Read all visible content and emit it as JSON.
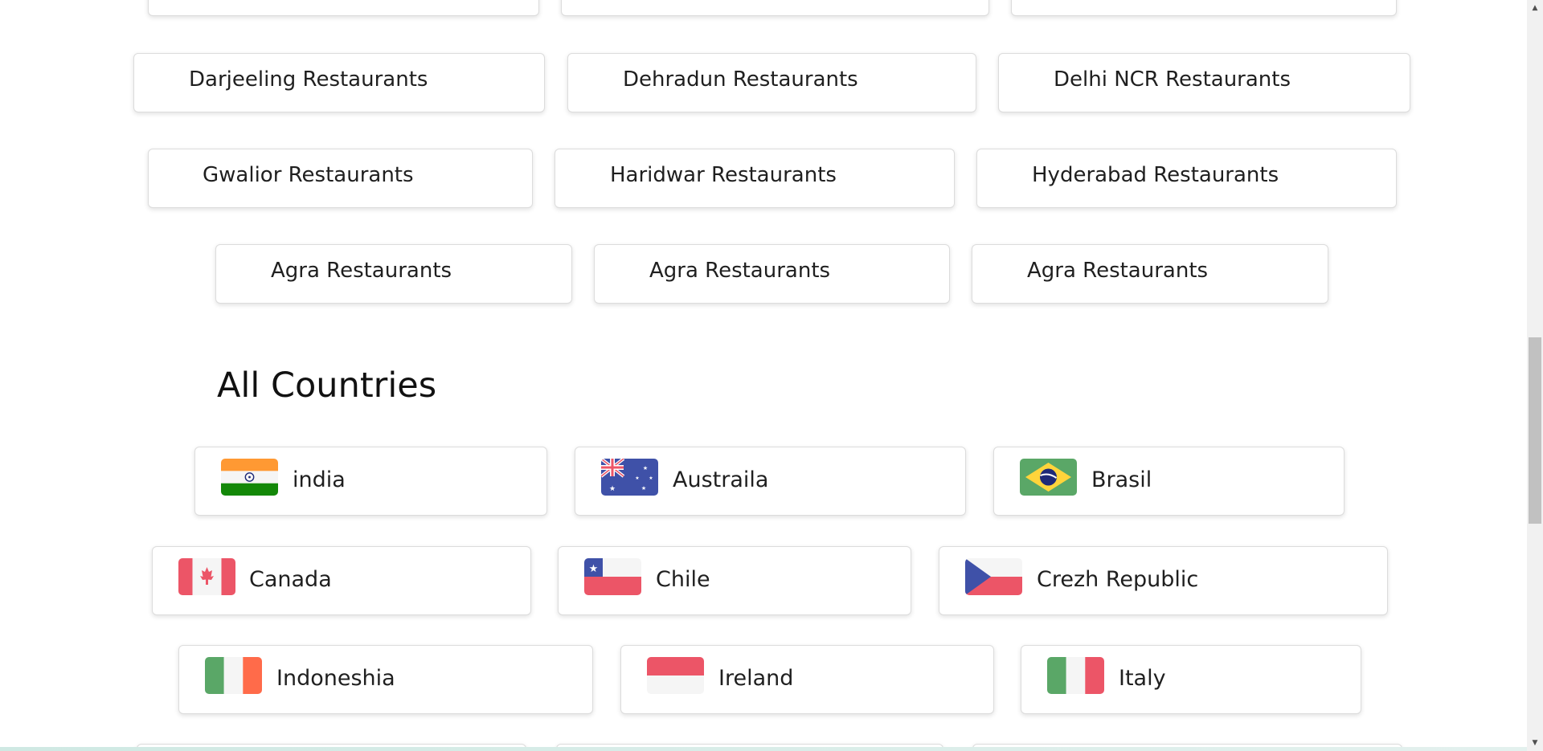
{
  "restaurants": {
    "row2": [
      "Darjeeling Restaurants",
      "Dehradun Restaurants",
      "Delhi NCR Restaurants"
    ],
    "row3": [
      "Gwalior Restaurants",
      "Haridwar Restaurants",
      "Hyderabad Restaurants"
    ],
    "row4": [
      "Agra Restaurants",
      "Agra Restaurants",
      "Agra Restaurants"
    ]
  },
  "countries_section": {
    "title": "All Countries",
    "items": [
      {
        "name": "india",
        "flag": "india-flag"
      },
      {
        "name": "Austraila",
        "flag": "australia-flag"
      },
      {
        "name": "Brasil",
        "flag": "brazil-flag"
      },
      {
        "name": "Canada",
        "flag": "canada-flag"
      },
      {
        "name": "Chile",
        "flag": "chile-flag"
      },
      {
        "name": "Crezh Republic",
        "flag": "czech-republic-flag"
      },
      {
        "name": "Indoneshia",
        "flag": "indonesia-flag"
      },
      {
        "name": "Ireland",
        "flag": "ireland-flag"
      },
      {
        "name": "Italy",
        "flag": "italy-flag"
      }
    ]
  },
  "colors": {
    "flag_red": "#ec5567",
    "flag_green": "#5aa767",
    "flag_orange": "#ff9933",
    "flag_blue": "#3f51a8",
    "flag_white": "#f5f5f5",
    "scrollbar_thumb": "#c1c1c1"
  }
}
